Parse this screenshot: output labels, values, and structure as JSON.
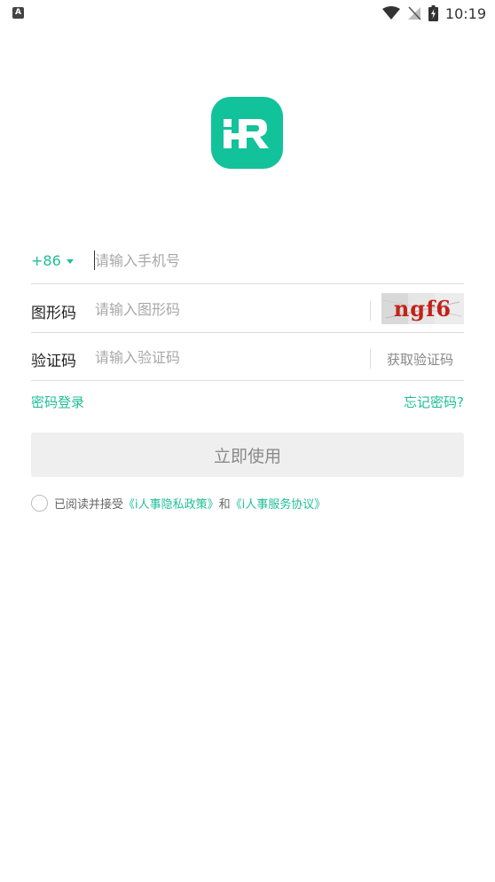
{
  "status_bar": {
    "time": "10:19",
    "left_icon": "A",
    "icons": [
      "wifi-icon",
      "no-signal-icon",
      "battery-icon"
    ]
  },
  "app": {
    "logo_icon": "ir-logo-icon",
    "brand_color": "#12c29a"
  },
  "form": {
    "country_code": "+86",
    "phone_placeholder": "请输入手机号",
    "captcha_label": "图形码",
    "captcha_placeholder": "请输入图形码",
    "captcha_text": "ngf6",
    "sms_label": "验证码",
    "sms_placeholder": "请输入验证码",
    "get_code_label": "获取验证码"
  },
  "links": {
    "password_login": "密码登录",
    "forgot_password": "忘记密码?"
  },
  "submit_label": "立即使用",
  "agreement": {
    "prefix": "已阅读并接受",
    "privacy_policy": "《i人事隐私政策》",
    "conjunction": "和",
    "service_agreement": "《i人事服务协议》"
  },
  "colors": {
    "accent": "#1fbe98",
    "captcha_text": "#c22218",
    "button_bg": "#efefef"
  }
}
